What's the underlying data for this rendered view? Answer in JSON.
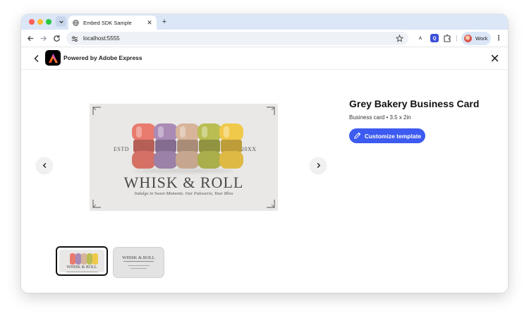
{
  "browser": {
    "tab_title": "Embed SDK Sample",
    "new_tab_label": "+",
    "url": "localhost:5555",
    "ext_a_label": "A",
    "ext_q_label": "Q",
    "profile_name": "Work"
  },
  "header": {
    "powered_by": "Powered by Adobe Express"
  },
  "template": {
    "title": "Grey Bakery Business Card",
    "subtitle": "Business card • 3.5 x 2in",
    "customize_label": "Customize template"
  },
  "card": {
    "estd": "ESTD",
    "year": "20XX",
    "brand": "WHISK & ROLL",
    "tagline": "Indulge in Sweet Moments. Our Patisserie, Your Bliss",
    "macaron_colors": [
      "#e87a6e",
      "#a98bb6",
      "#d7b49a",
      "#b9bd52",
      "#f1c94a"
    ]
  },
  "thumbnails": {
    "front_brand": "WHISK & ROLL",
    "back_brand": "WHISK & ROLL",
    "selected_index": 0
  },
  "icons": {
    "tab_globe": "globe-icon",
    "back": "chevron-left-icon",
    "close": "close-icon",
    "prev": "chevron-left-icon",
    "next": "chevron-right-icon",
    "edit": "pencil-icon"
  }
}
